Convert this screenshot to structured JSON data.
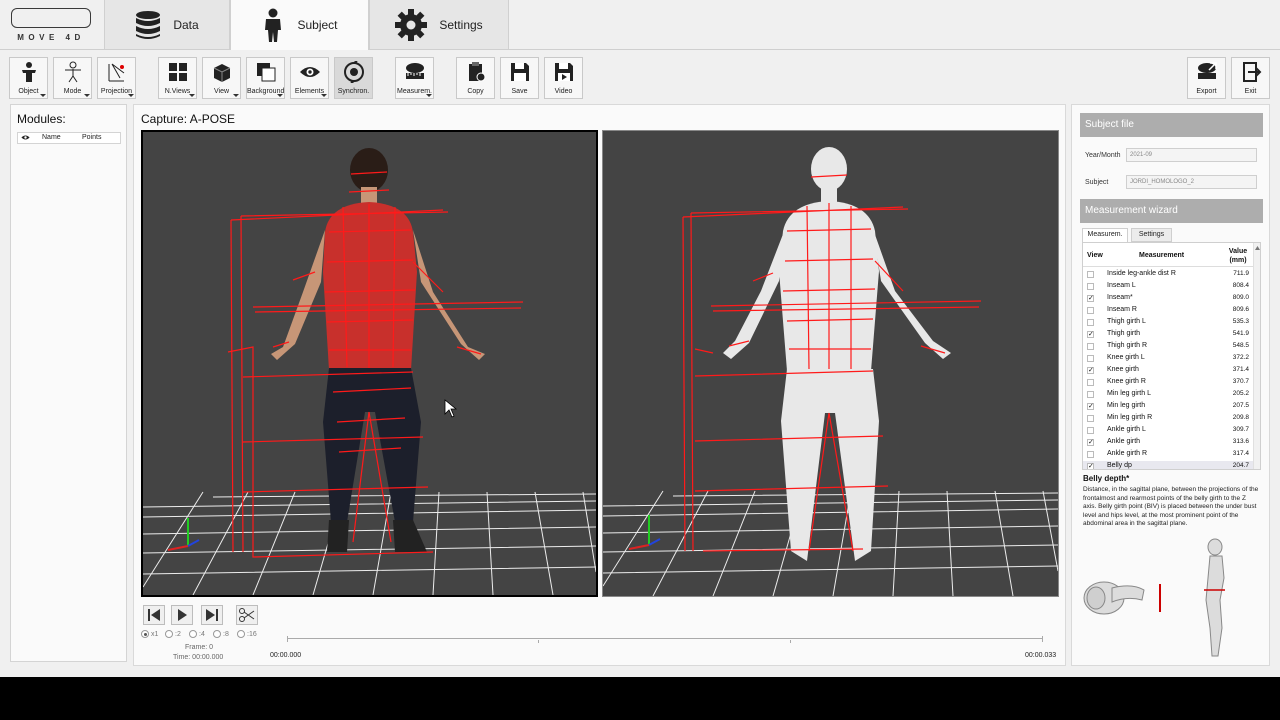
{
  "app": {
    "logo_text": "MOVE 4D",
    "tabs": [
      {
        "label": "Data",
        "icon": "database-icon"
      },
      {
        "label": "Subject",
        "icon": "person-icon"
      },
      {
        "label": "Settings",
        "icon": "gear-icon"
      }
    ]
  },
  "toolbar": {
    "object": "Object",
    "mode": "Mode",
    "projection": "Projection",
    "nviews": "N.Views",
    "view": "View",
    "background": "Background",
    "elements": "Elements",
    "synchron": "Synchron.",
    "measurem": "Measurem.",
    "copy": "Copy",
    "save": "Save",
    "video": "Video",
    "export": "Export",
    "exit": "Exit"
  },
  "modules": {
    "title": "Modules:",
    "col_name": "Name",
    "col_points": "Points"
  },
  "capture": {
    "title": "Capture: A-POSE"
  },
  "player": {
    "speeds": [
      "x1",
      ":2",
      ":4",
      ":8",
      ":16"
    ],
    "frame": "Frame: 0",
    "time": "Time: 00:00.000",
    "start_time": "00:00.000",
    "end_time": "00:00.033"
  },
  "subject_file": {
    "header": "Subject file",
    "year_month_label": "Year/Month",
    "year_month_value": "2021-09",
    "subject_label": "Subject",
    "subject_value": "JORDI_HOMOLOGO_2"
  },
  "wizard": {
    "header": "Measurement wizard",
    "tab_measurem": "Measurem.",
    "tab_settings": "Settings",
    "col_view": "View",
    "col_measurement": "Measurement",
    "col_value": "Value (mm)",
    "rows": [
      {
        "name": "Inside leg-ankle dist R",
        "value": "711.9",
        "checked": false
      },
      {
        "name": "Inseam L",
        "value": "808.4",
        "checked": false
      },
      {
        "name": "Inseam*",
        "value": "809.0",
        "checked": true
      },
      {
        "name": "Inseam R",
        "value": "809.6",
        "checked": false
      },
      {
        "name": "Thigh girth L",
        "value": "535.3",
        "checked": false
      },
      {
        "name": "Thigh girth",
        "value": "541.9",
        "checked": true
      },
      {
        "name": "Thigh girth R",
        "value": "548.5",
        "checked": false
      },
      {
        "name": "Knee girth L",
        "value": "372.2",
        "checked": false
      },
      {
        "name": "Knee girth",
        "value": "371.4",
        "checked": true
      },
      {
        "name": "Knee girth R",
        "value": "370.7",
        "checked": false
      },
      {
        "name": "Min leg girth L",
        "value": "205.2",
        "checked": false
      },
      {
        "name": "Min leg girth",
        "value": "207.5",
        "checked": true
      },
      {
        "name": "Min leg girth R",
        "value": "209.8",
        "checked": false
      },
      {
        "name": "Ankle girth L",
        "value": "309.7",
        "checked": false
      },
      {
        "name": "Ankle girth",
        "value": "313.6",
        "checked": true
      },
      {
        "name": "Ankle girth R",
        "value": "317.4",
        "checked": false
      },
      {
        "name": "Belly dp",
        "value": "204.7",
        "checked": true
      }
    ],
    "selected_title": "Belly depth*",
    "selected_description": "Distance, in the sagittal plane, between the projections of the frontalmost and rearmost points of the belly girth to the Z axis. Belly girth point (BIV) is placed between the under bust level and hips level, at the most prominent point of the abdominal area in the sagittal plane."
  },
  "colors": {
    "measure_line": "#ff1a1a",
    "viewport_bg": "#444444",
    "section_header": "#adadad"
  }
}
